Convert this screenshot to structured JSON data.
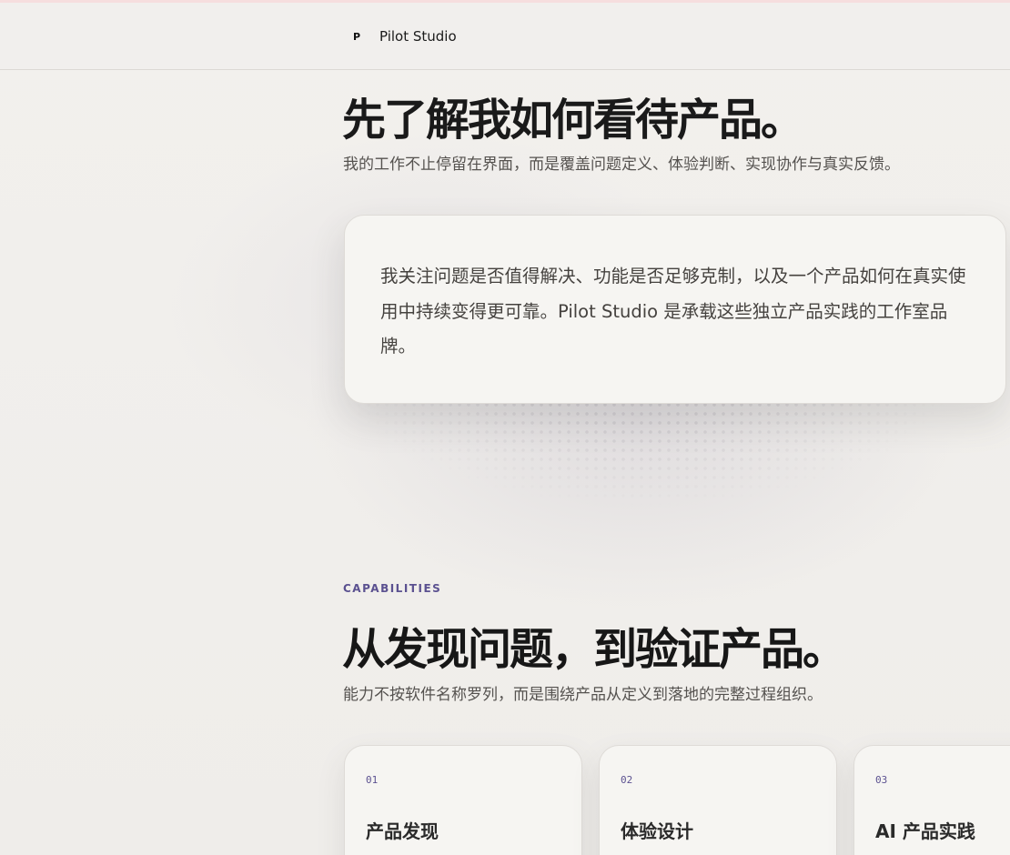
{
  "brand": {
    "mark": "P",
    "name": "Pilot Studio"
  },
  "intro": {
    "title": "先了解我如何看待产品。",
    "subtitle": "我的工作不止停留在界面，而是覆盖问题定义、体验判断、实现协作与真实反馈。",
    "card_text": "我关注问题是否值得解决、功能是否足够克制，以及一个产品如何在真实使用中持续变得更可靠。Pilot Studio 是承载这些独立产品实践的工作室品牌。"
  },
  "capabilities": {
    "eyebrow": "CAPABILITIES",
    "title": "从发现问题，到验证产品。",
    "subtitle": "能力不按软件名称罗列，而是围绕产品从定义到落地的完整过程组织。",
    "cards": [
      {
        "number": "01",
        "title": "产品发现"
      },
      {
        "number": "02",
        "title": "体验设计"
      },
      {
        "number": "03",
        "title": "AI 产品实践"
      }
    ]
  },
  "colors": {
    "accent": "#5b5190",
    "background": "#f0eeeb",
    "card": "#f6f5f2"
  }
}
